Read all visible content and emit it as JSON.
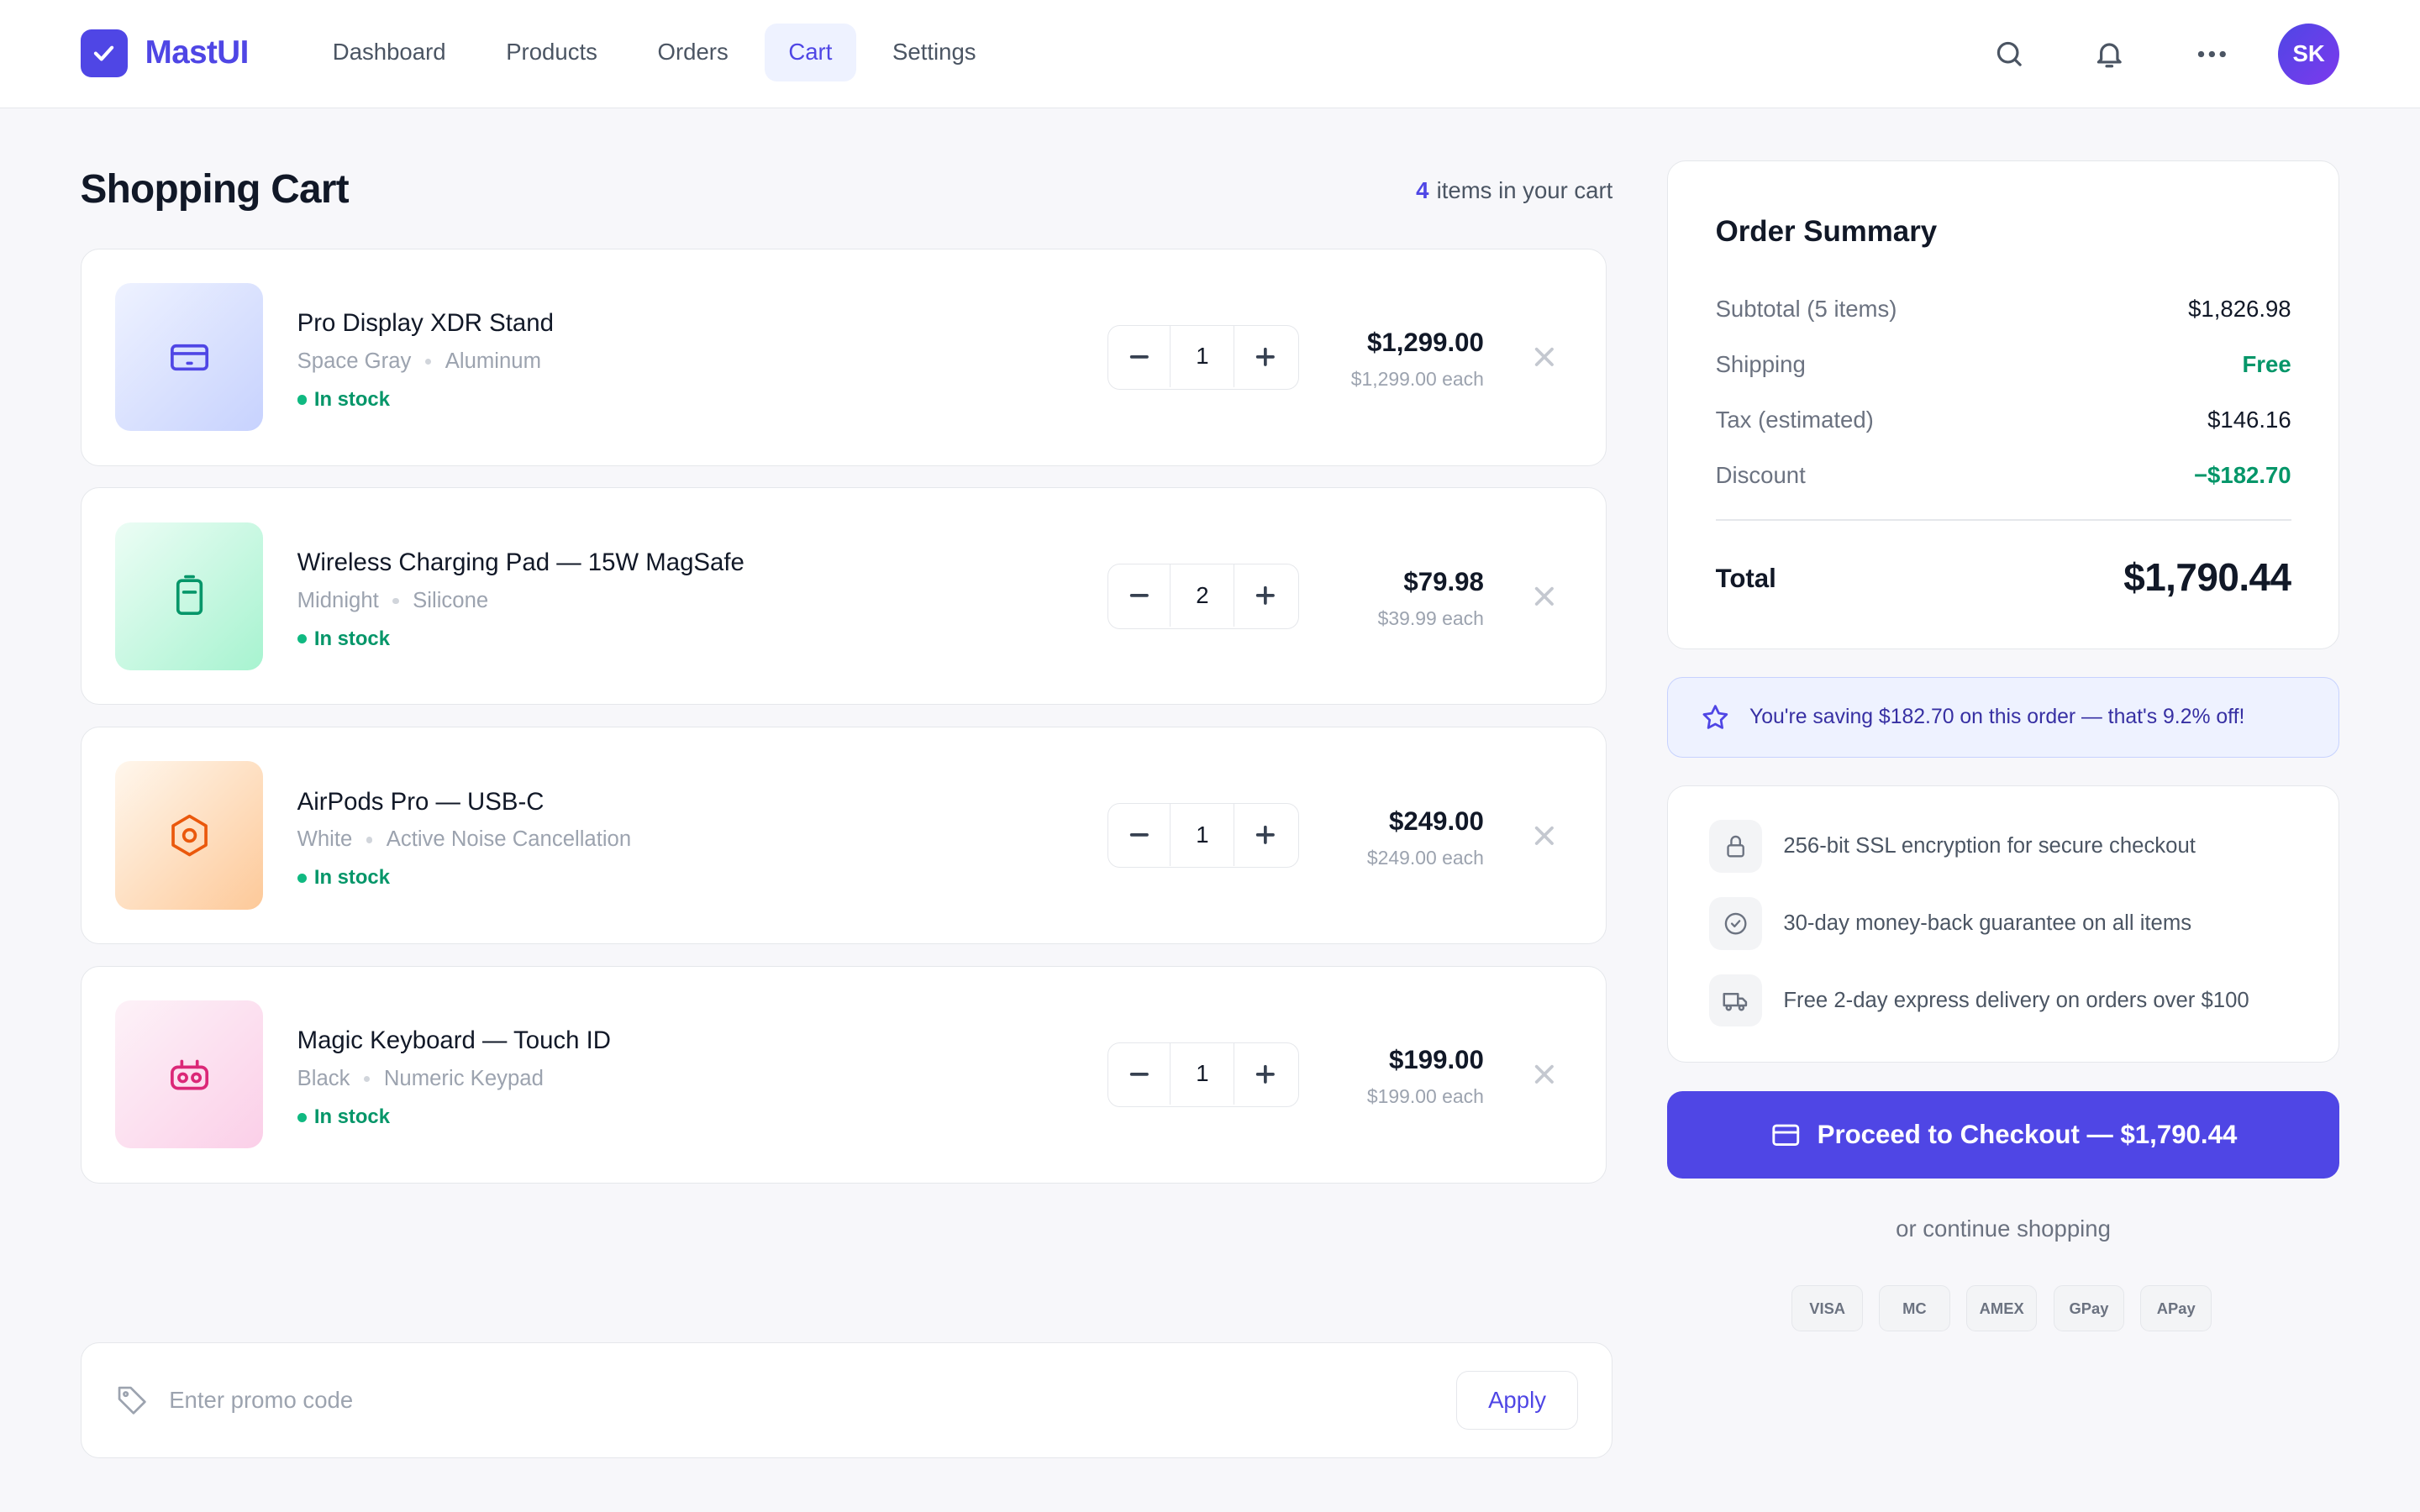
{
  "app": {
    "name": "MastUI",
    "user_initials": "SK"
  },
  "nav": [
    {
      "label": "Dashboard",
      "active": false
    },
    {
      "label": "Products",
      "active": false
    },
    {
      "label": "Orders",
      "active": false
    },
    {
      "label": "Cart",
      "active": true
    },
    {
      "label": "Settings",
      "active": false
    }
  ],
  "header_icons": [
    "search-icon",
    "bell-icon",
    "more-icon"
  ],
  "cart": {
    "title": "Shopping Cart",
    "count": "4",
    "count_suffix": "items in your cart",
    "stock_label": "In stock",
    "items": [
      {
        "name": "Pro Display XDR Stand",
        "variant1": "Space Gray",
        "variant2": "Aluminum",
        "qty": "1",
        "price": "$1,299.00",
        "each": "$1,299.00 each",
        "icon": "card-icon",
        "color": "#4f46e5"
      },
      {
        "name": "Wireless Charging Pad — 15W MagSafe",
        "variant1": "Midnight",
        "variant2": "Silicone",
        "qty": "2",
        "price": "$79.98",
        "each": "$39.99 each",
        "icon": "battery-icon",
        "color": "#059669"
      },
      {
        "name": "AirPods Pro — USB-C",
        "variant1": "White",
        "variant2": "Active Noise Cancellation",
        "qty": "1",
        "price": "$249.00",
        "each": "$249.00 each",
        "icon": "hexagon-icon",
        "color": "#ea580c"
      },
      {
        "name": "Magic Keyboard — Touch ID",
        "variant1": "Black",
        "variant2": "Numeric Keypad",
        "qty": "1",
        "price": "$199.00",
        "each": "$199.00 each",
        "icon": "keyboard-icon",
        "color": "#db2777"
      }
    ]
  },
  "promo": {
    "placeholder": "Enter promo code",
    "apply_label": "Apply"
  },
  "summary": {
    "title": "Order Summary",
    "rows": [
      {
        "label": "Subtotal (5 items)",
        "value": "$1,826.98"
      },
      {
        "label": "Shipping",
        "value": "Free"
      },
      {
        "label": "Tax (estimated)",
        "value": "$146.16"
      },
      {
        "label": "Discount",
        "value": "−$182.70"
      }
    ],
    "total_label": "Total",
    "total_value": "$1,790.44"
  },
  "saving": {
    "text": "You're saving $182.70 on this order — that's 9.2% off!"
  },
  "trust": [
    {
      "icon": "lock-icon",
      "text": "256-bit SSL encryption for secure checkout"
    },
    {
      "icon": "check-circle-icon",
      "text": "30-day money-back guarantee on all items"
    },
    {
      "icon": "truck-icon",
      "text": "Free 2-day express delivery on orders over $100"
    }
  ],
  "checkout": {
    "label": "Proceed to Checkout — $1,790.44",
    "continue_label": "or continue shopping"
  },
  "payment_methods": [
    "VISA",
    "MC",
    "AMEX",
    "GPay",
    "APay"
  ],
  "colors": {
    "accent": "#4f46e5",
    "success": "#059669",
    "background": "#f7f7fa"
  }
}
